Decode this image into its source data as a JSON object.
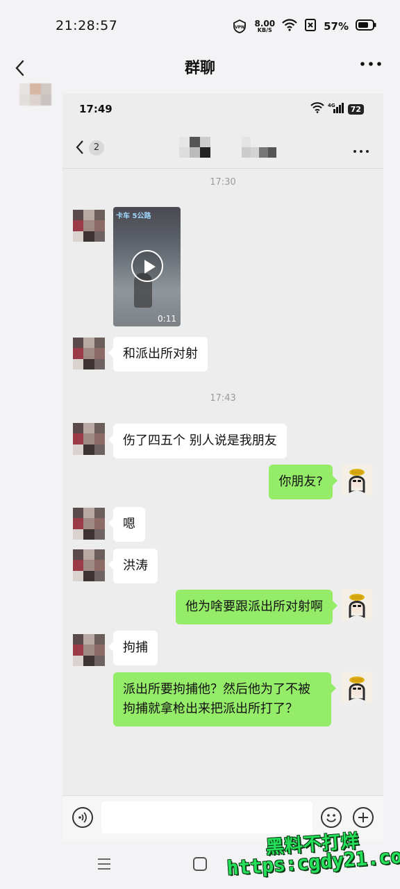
{
  "status_bar": {
    "time": "21:28:57",
    "vpn_label": "VPN",
    "speed_value": "8.00",
    "speed_unit": "KB/S",
    "battery_percent": "57%"
  },
  "header": {
    "title": "群聊",
    "back_icon": "chevron-left-icon",
    "more_icon": "more-dots-icon"
  },
  "inner_screenshot": {
    "status_time": "17:49",
    "network_label": "4G",
    "battery_level": "72",
    "unread_badge": "2",
    "messages": [
      {
        "type": "timestamp",
        "text": "17:30"
      },
      {
        "type": "video",
        "side": "left",
        "duration": "0:11",
        "caption": "卡车 5公路"
      },
      {
        "type": "text",
        "side": "left",
        "text": "和派出所对射"
      },
      {
        "type": "timestamp",
        "text": "17:43"
      },
      {
        "type": "text",
        "side": "left",
        "text": "伤了四五个  别人说是我朋友"
      },
      {
        "type": "text",
        "side": "right",
        "text": "你朋友?"
      },
      {
        "type": "text",
        "side": "left",
        "text": "嗯"
      },
      {
        "type": "text",
        "side": "left",
        "text": "洪涛"
      },
      {
        "type": "text",
        "side": "right",
        "text": "他为啥要跟派出所对射啊"
      },
      {
        "type": "text",
        "side": "left",
        "text": "拘捕"
      },
      {
        "type": "text",
        "side": "right",
        "text": "派出所要拘捕他？然后他为了不被拘捕就拿枪出来把派出所打了？"
      }
    ]
  },
  "watermark": {
    "line1": "黑料不打烊",
    "line2": "https:cgdy21.com"
  },
  "colors": {
    "my_bubble": "#95ec69",
    "their_bubble": "#ffffff",
    "chat_bg": "#ededed",
    "watermark": "#25e05a"
  }
}
